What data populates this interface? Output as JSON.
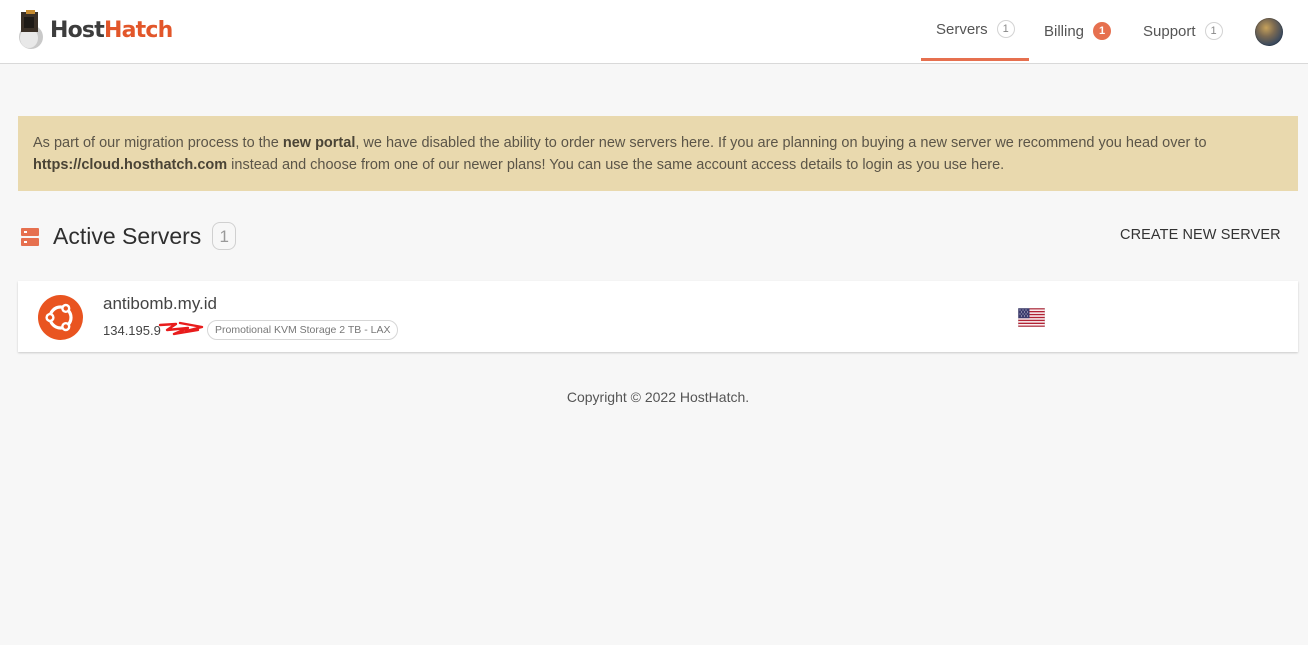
{
  "brand": {
    "part1": "Host",
    "part2": "Hatch"
  },
  "nav": {
    "items": [
      {
        "label": "Servers",
        "count": "1"
      },
      {
        "label": "Billing",
        "count": "1"
      },
      {
        "label": "Support",
        "count": "1"
      }
    ]
  },
  "notice": {
    "pre": "As part of our migration process to the ",
    "bold1": "new portal",
    "mid": ", we have disabled the ability to order new servers here. If you are planning on buying a new server we recommend you head over to ",
    "bold2": "https://cloud.hosthatch.com",
    "post": " instead and choose from one of our newer plans! You can use the same account access details to login as you use here."
  },
  "section": {
    "title": "Active Servers",
    "count": "1",
    "create_label": "CREATE NEW SERVER"
  },
  "servers": [
    {
      "hostname": "antibomb.my.id",
      "ip": "134.195.9",
      "plan": "Promotional KVM Storage 2 TB - LAX",
      "os_icon": "ubuntu-icon",
      "flag": "us-flag-icon"
    }
  ],
  "footer": {
    "copyright": "Copyright © 2022 HostHatch."
  },
  "colors": {
    "accent": "#e6704f",
    "notice_bg": "#e9d9ae",
    "ubuntu": "#e95420"
  }
}
